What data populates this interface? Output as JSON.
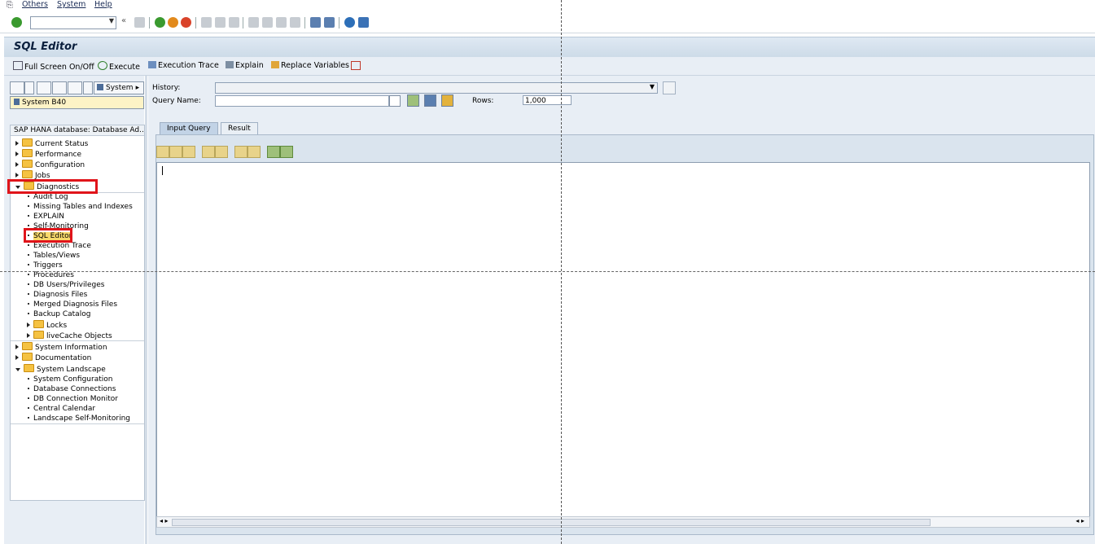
{
  "menu": {
    "others": "Others",
    "system": "System",
    "help": "Help"
  },
  "title": "SQL Editor",
  "app_toolbar": {
    "fullscreen": "Full Screen On/Off",
    "execute": "Execute",
    "execution_trace": "Execution Trace",
    "explain": "Explain",
    "replace_variables": "Replace Variables"
  },
  "left": {
    "system_button": "System",
    "system_field": "System B40",
    "tree_header": "SAP HANA database: Database Ad...",
    "tree": [
      {
        "label": "Current Status",
        "kind": "folder",
        "state": "collapsed"
      },
      {
        "label": "Performance",
        "kind": "folder",
        "state": "collapsed"
      },
      {
        "label": "Configuration",
        "kind": "folder",
        "state": "collapsed"
      },
      {
        "label": "Jobs",
        "kind": "folder",
        "state": "collapsed"
      },
      {
        "label": "Diagnostics",
        "kind": "folder",
        "state": "expanded"
      },
      {
        "label": "Audit Log",
        "kind": "leaf"
      },
      {
        "label": "Missing Tables and Indexes",
        "kind": "leaf"
      },
      {
        "label": "EXPLAIN",
        "kind": "leaf"
      },
      {
        "label": "Self-Monitoring",
        "kind": "leaf"
      },
      {
        "label": "SQL Editor",
        "kind": "leaf",
        "selected": true
      },
      {
        "label": "Execution Trace",
        "kind": "leaf"
      },
      {
        "label": "Tables/Views",
        "kind": "leaf"
      },
      {
        "label": "Triggers",
        "kind": "leaf"
      },
      {
        "label": "Procedures",
        "kind": "leaf"
      },
      {
        "label": "DB Users/Privileges",
        "kind": "leaf"
      },
      {
        "label": "Diagnosis Files",
        "kind": "leaf"
      },
      {
        "label": "Merged Diagnosis Files",
        "kind": "leaf"
      },
      {
        "label": "Backup Catalog",
        "kind": "leaf"
      },
      {
        "label": "Locks",
        "kind": "subfolder"
      },
      {
        "label": "liveCache Objects",
        "kind": "subfolder"
      },
      {
        "label": "System Information",
        "kind": "folder",
        "state": "collapsed"
      },
      {
        "label": "Documentation",
        "kind": "folder",
        "state": "collapsed"
      },
      {
        "label": "System Landscape",
        "kind": "folder",
        "state": "expanded"
      },
      {
        "label": "System Configuration",
        "kind": "leaf"
      },
      {
        "label": "Database Connections",
        "kind": "leaf"
      },
      {
        "label": "DB Connection Monitor",
        "kind": "leaf"
      },
      {
        "label": "Central Calendar",
        "kind": "leaf"
      },
      {
        "label": "Landscape Self-Monitoring",
        "kind": "leaf"
      }
    ]
  },
  "right": {
    "history_label": "History:",
    "query_name_label": "Query Name:",
    "rows_label": "Rows:",
    "rows_value": "1,000",
    "tabs": {
      "input": "Input Query",
      "result": "Result"
    }
  },
  "colors": {
    "highlight": "#e0141a",
    "folder": "#f5c242"
  }
}
